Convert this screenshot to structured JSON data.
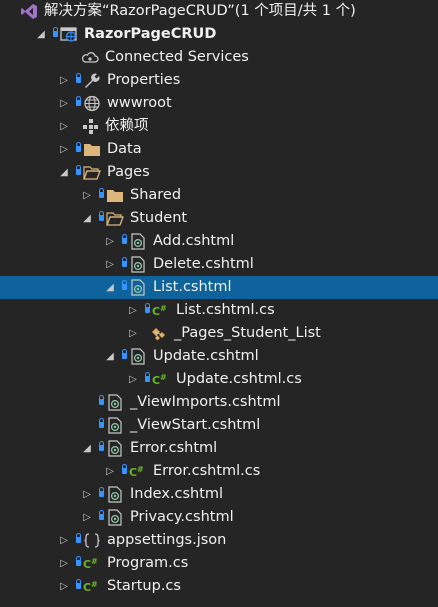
{
  "rows": [
    {
      "label": "解决方案“RazorPageCRUD”(1 个项目/共 1 个)",
      "icon": "visual-studio-solution-icon",
      "indent": 0,
      "expand": "none",
      "lock": false
    },
    {
      "label": "RazorPageCRUD",
      "icon": "web-project-icon",
      "indent": 1,
      "expand": "open",
      "lock": true,
      "bold": true
    },
    {
      "label": "Connected Services",
      "icon": "connected-services-icon",
      "indent": 2,
      "expand": "none",
      "lock": false
    },
    {
      "label": "Properties",
      "icon": "wrench-icon",
      "indent": 2,
      "expand": "closed",
      "lock": true
    },
    {
      "label": "wwwroot",
      "icon": "globe-icon",
      "indent": 2,
      "expand": "closed",
      "lock": true
    },
    {
      "label": "依赖项",
      "icon": "dependencies-icon",
      "indent": 2,
      "expand": "closed",
      "lock": false
    },
    {
      "label": "Data",
      "icon": "folder-icon",
      "indent": 2,
      "expand": "closed",
      "lock": true
    },
    {
      "label": "Pages",
      "icon": "folder-open-icon",
      "indent": 2,
      "expand": "open",
      "lock": true
    },
    {
      "label": "Shared",
      "icon": "folder-icon",
      "indent": 3,
      "expand": "closed",
      "lock": true
    },
    {
      "label": "Student",
      "icon": "folder-open-icon",
      "indent": 3,
      "expand": "open",
      "lock": true
    },
    {
      "label": "Add.cshtml",
      "icon": "razor-file-icon",
      "indent": 4,
      "expand": "closed",
      "lock": true
    },
    {
      "label": "Delete.cshtml",
      "icon": "razor-file-icon",
      "indent": 4,
      "expand": "closed",
      "lock": true
    },
    {
      "label": "List.cshtml",
      "icon": "razor-file-icon",
      "indent": 4,
      "expand": "open",
      "lock": true,
      "selected": true
    },
    {
      "label": "List.cshtml.cs",
      "icon": "csharp-file-icon",
      "indent": 5,
      "expand": "closed",
      "lock": true
    },
    {
      "label": "_Pages_Student_List",
      "icon": "class-icon",
      "indent": 5,
      "expand": "closed",
      "lock": false
    },
    {
      "label": "Update.cshtml",
      "icon": "razor-file-icon",
      "indent": 4,
      "expand": "open",
      "lock": true
    },
    {
      "label": "Update.cshtml.cs",
      "icon": "csharp-file-icon",
      "indent": 5,
      "expand": "closed",
      "lock": true
    },
    {
      "label": "_ViewImports.cshtml",
      "icon": "razor-file-icon",
      "indent": 3,
      "expand": "none",
      "lock": true
    },
    {
      "label": "_ViewStart.cshtml",
      "icon": "razor-file-icon",
      "indent": 3,
      "expand": "none",
      "lock": true
    },
    {
      "label": "Error.cshtml",
      "icon": "razor-file-icon",
      "indent": 3,
      "expand": "open",
      "lock": true
    },
    {
      "label": "Error.cshtml.cs",
      "icon": "csharp-file-icon",
      "indent": 4,
      "expand": "closed",
      "lock": true
    },
    {
      "label": "Index.cshtml",
      "icon": "razor-file-icon",
      "indent": 3,
      "expand": "closed",
      "lock": true
    },
    {
      "label": "Privacy.cshtml",
      "icon": "razor-file-icon",
      "indent": 3,
      "expand": "closed",
      "lock": true
    },
    {
      "label": "appsettings.json",
      "icon": "json-file-icon",
      "indent": 2,
      "expand": "closed",
      "lock": true
    },
    {
      "label": "Program.cs",
      "icon": "csharp-file-icon",
      "indent": 2,
      "expand": "closed",
      "lock": true
    },
    {
      "label": "Startup.cs",
      "icon": "csharp-file-icon",
      "indent": 2,
      "expand": "closed",
      "lock": true
    }
  ],
  "colors": {
    "background": "#252526",
    "selected": "#0e639c",
    "text": "#f1f1f1",
    "lock": "#3794ff",
    "folder": "#dcb67a",
    "csharp": "#68b723",
    "razor": "#8fc9a6",
    "vs_purple": "#a074c4"
  }
}
